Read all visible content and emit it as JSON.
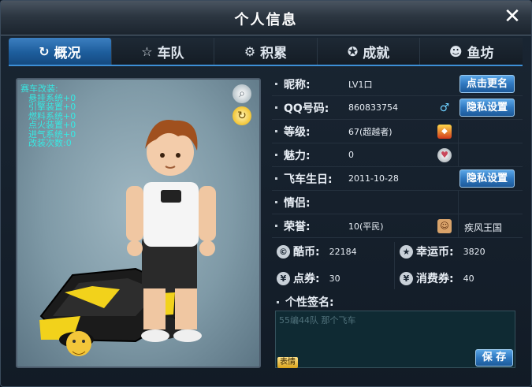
{
  "window": {
    "title": "个人信息",
    "close_symbol": "✕"
  },
  "tabs": [
    {
      "label": "概况",
      "icon": "refresh-circle-icon",
      "glyph": "↻",
      "active": true
    },
    {
      "label": "车队",
      "icon": "star-icon",
      "glyph": "☆",
      "active": false
    },
    {
      "label": "积累",
      "icon": "gear-icon",
      "glyph": "⚙",
      "active": false
    },
    {
      "label": "成就",
      "icon": "medal-icon",
      "glyph": "✪",
      "active": false
    },
    {
      "label": "鱼坊",
      "icon": "fish-face-icon",
      "glyph": "☻",
      "active": false
    }
  ],
  "avatar_panel": {
    "mods_title": "赛车改装:",
    "mods": [
      "悬挂系统+0",
      "引擎装置+0",
      "燃料系统+0",
      "点火装置+0",
      "进气系统+0",
      "改装次数:0"
    ]
  },
  "profile": {
    "nickname_label": "昵称:",
    "nickname_value": "LV1口",
    "rename_button": "点击更名",
    "qq_label": "QQ号码:",
    "qq_value": "860833754",
    "privacy_button": "隐私设置",
    "level_label": "等级:",
    "level_value": "67(超越者)",
    "charm_label": "魅力:",
    "charm_value": "0",
    "birthday_label": "飞车生日:",
    "birthday_value": "2011-10-28",
    "birthday_privacy_button": "隐私设置",
    "partner_label": "情侣:",
    "partner_value": "",
    "honor_label": "荣誉:",
    "honor_value": "10(平民)",
    "honor_extra": "疾风王国"
  },
  "currency": {
    "cool_label": "酷币:",
    "cool_value": "22184",
    "lucky_label": "幸运币:",
    "lucky_value": "3820",
    "points_label": "点券:",
    "points_value": "30",
    "consume_label": "消费券:",
    "consume_value": "40"
  },
  "signature": {
    "label": "个性签名:",
    "text": "55编44队 那个飞车",
    "emoji_button": "表情",
    "save_button": "保 存"
  }
}
